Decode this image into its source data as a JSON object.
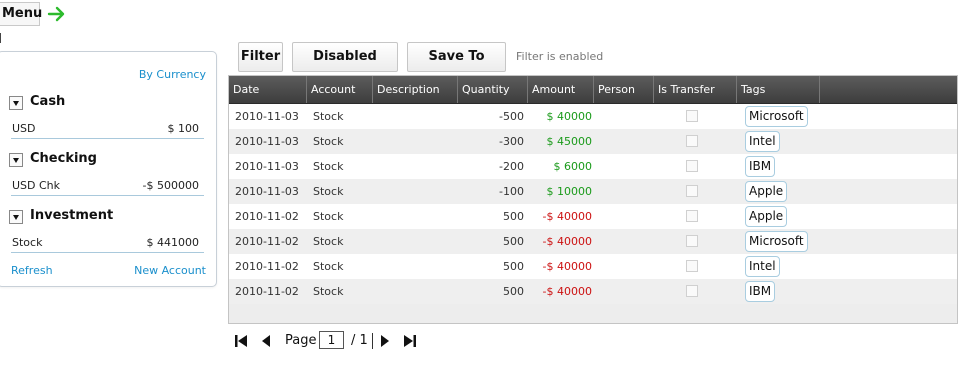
{
  "menu": {
    "label": "Menu"
  },
  "accounts_panel": {
    "by_currency": "By Currency",
    "groups": [
      {
        "name": "Cash",
        "accounts": [
          {
            "name": "USD",
            "balance": "$ 100"
          }
        ]
      },
      {
        "name": "Checking",
        "accounts": [
          {
            "name": "USD Chk",
            "balance": "-$ 500000"
          }
        ]
      },
      {
        "name": "Investment",
        "accounts": [
          {
            "name": "Stock",
            "balance": "$ 441000"
          }
        ]
      }
    ],
    "refresh": "Refresh",
    "new_account": "New Account"
  },
  "toolbar": {
    "filter": "Filter",
    "disabled_filter": "Disabled Filter",
    "save_to_excel": "Save To Excel",
    "status": "Filter is enabled"
  },
  "grid": {
    "columns": [
      "Date",
      "Account",
      "Description",
      "Quantity",
      "Amount",
      "Person",
      "Is Transfer",
      "Tags"
    ],
    "rows": [
      {
        "date": "2010-11-03",
        "account": "Stock",
        "description": "",
        "quantity": "-500",
        "amount": "$ 40000",
        "amount_sign": "pos",
        "person": "",
        "is_transfer": false,
        "tag": "Microsoft"
      },
      {
        "date": "2010-11-03",
        "account": "Stock",
        "description": "",
        "quantity": "-300",
        "amount": "$ 45000",
        "amount_sign": "pos",
        "person": "",
        "is_transfer": false,
        "tag": "Intel"
      },
      {
        "date": "2010-11-03",
        "account": "Stock",
        "description": "",
        "quantity": "-200",
        "amount": "$ 6000",
        "amount_sign": "pos",
        "person": "",
        "is_transfer": false,
        "tag": "IBM"
      },
      {
        "date": "2010-11-03",
        "account": "Stock",
        "description": "",
        "quantity": "-100",
        "amount": "$ 10000",
        "amount_sign": "pos",
        "person": "",
        "is_transfer": false,
        "tag": "Apple"
      },
      {
        "date": "2010-11-02",
        "account": "Stock",
        "description": "",
        "quantity": "500",
        "amount": "-$ 40000",
        "amount_sign": "neg",
        "person": "",
        "is_transfer": false,
        "tag": "Apple"
      },
      {
        "date": "2010-11-02",
        "account": "Stock",
        "description": "",
        "quantity": "500",
        "amount": "-$ 40000",
        "amount_sign": "neg",
        "person": "",
        "is_transfer": false,
        "tag": "Microsoft"
      },
      {
        "date": "2010-11-02",
        "account": "Stock",
        "description": "",
        "quantity": "500",
        "amount": "-$ 40000",
        "amount_sign": "neg",
        "person": "",
        "is_transfer": false,
        "tag": "Intel"
      },
      {
        "date": "2010-11-02",
        "account": "Stock",
        "description": "",
        "quantity": "500",
        "amount": "-$ 40000",
        "amount_sign": "neg",
        "person": "",
        "is_transfer": false,
        "tag": "IBM"
      }
    ]
  },
  "pager": {
    "page_label": "Page",
    "current_page": "1",
    "total": "/ 1"
  },
  "colors": {
    "positive": "#1a9a1a",
    "negative": "#cc1111",
    "link": "#1a8fcc",
    "header": "#4a4a4a"
  },
  "icons": [
    "arrow-right-icon",
    "first-page-icon",
    "prev-page-icon",
    "next-page-icon",
    "last-page-icon",
    "collapse-triangle-icon"
  ]
}
